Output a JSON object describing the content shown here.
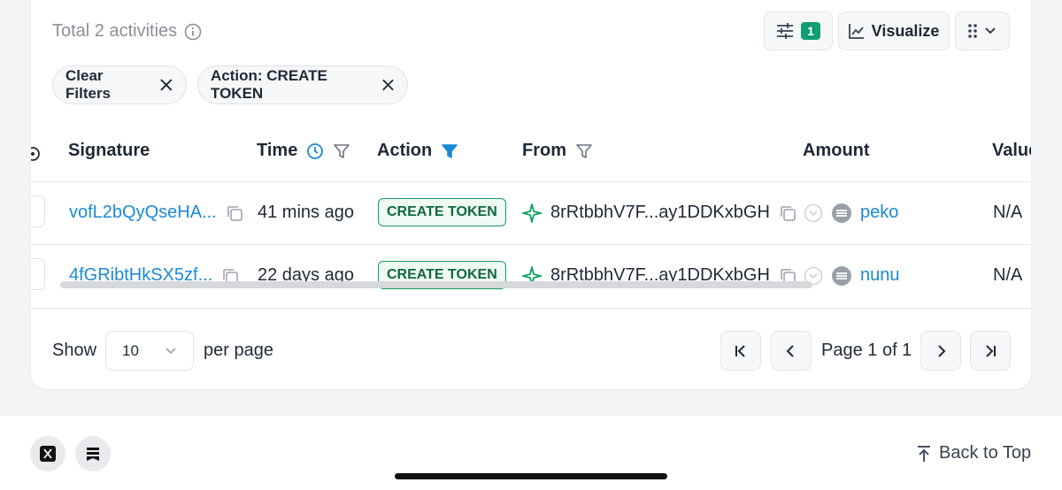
{
  "header": {
    "total_label": "Total 2 activities",
    "filter_count": "1",
    "visualize_label": "Visualize"
  },
  "filters": {
    "clear_label": "Clear Filters",
    "active": [
      "Action: CREATE TOKEN"
    ]
  },
  "table": {
    "columns": [
      "Signature",
      "Time",
      "Action",
      "From",
      "Amount",
      "Value"
    ],
    "rows": [
      {
        "signature": "vofL2bQyQseHA...",
        "time": "41 mins ago",
        "action": "CREATE TOKEN",
        "from": "8rRtbbhV7F...ay1DDKxbGH",
        "amount": "peko",
        "value": "N/A"
      },
      {
        "signature": "4fGRibtHkSX5zf...",
        "time": "22 days ago",
        "action": "CREATE TOKEN",
        "from": "8rRtbbhV7F...ay1DDKxbGH",
        "amount": "nunu",
        "value": "N/A"
      }
    ]
  },
  "pagination": {
    "show_label": "Show",
    "per_page_value": "10",
    "per_page_label": "per page",
    "page_label": "Page 1 of 1"
  },
  "footer": {
    "back_to_top": "Back to Top"
  },
  "colors": {
    "link": "#1a8ad6",
    "success": "#14a05e",
    "badge": "#0f9d73"
  }
}
